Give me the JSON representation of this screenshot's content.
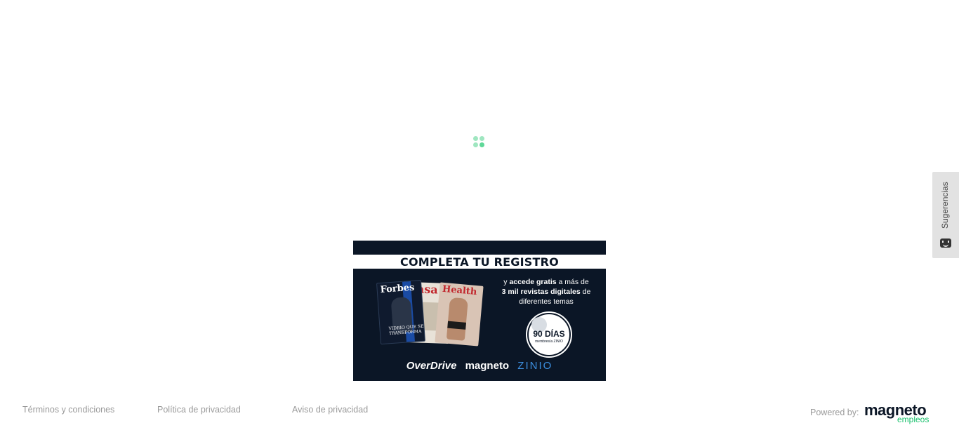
{
  "loader": {
    "icon": "loading-dots-icon",
    "colors": [
      "#9fe6c0",
      "#5fd898"
    ]
  },
  "banner": {
    "headline": "COMPLETA TU REGISTRO",
    "magazines": [
      "Forbes",
      "casa",
      "Health"
    ],
    "forbes_caption": "VIDRIO QUE SE TRANSFORMA",
    "text_line1_pre": "y ",
    "text_line1_bold": "accede gratis",
    "text_line1_post": " a más de",
    "text_line2_bold": "3 mil revistas digitales",
    "text_line2_post": " de",
    "text_line3": "diferentes temas",
    "badge_main": "90 DÍAS",
    "badge_sub": "membresía ZINIO",
    "brands": [
      "OverDrive",
      "magneto",
      "ZINIO"
    ],
    "colors": {
      "background": "#0b1626",
      "zinio": "#3c8fe0"
    }
  },
  "suggestions": {
    "label": "Sugerencias",
    "icon": "feedback-face-icon"
  },
  "footer": {
    "links": [
      "Términos y condiciones",
      "Política de privacidad",
      "Aviso de privacidad"
    ],
    "powered_by": "Powered by:",
    "logo_main": "magneto",
    "logo_sub": "empleos",
    "colors": {
      "brand_green": "#18c06c",
      "brand_dark": "#0b1626"
    }
  }
}
